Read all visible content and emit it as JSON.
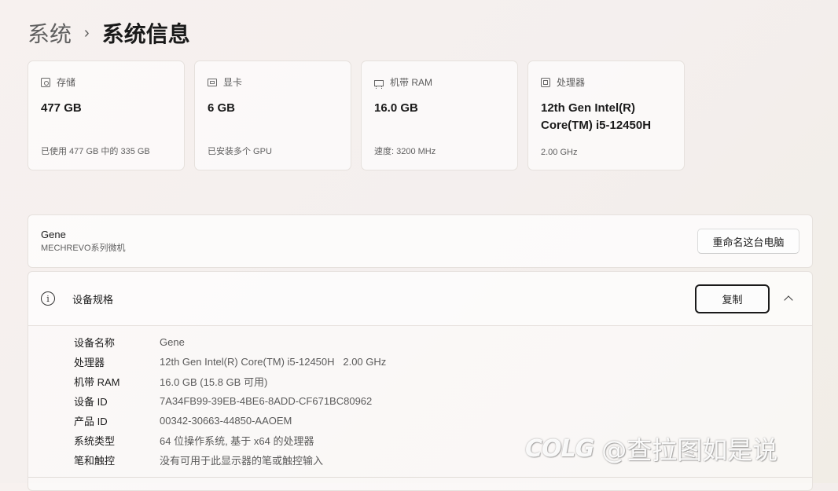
{
  "breadcrumb": {
    "parent": "系统",
    "separator": "›",
    "current": "系统信息"
  },
  "cards": [
    {
      "icon": "storage-icon",
      "title": "存储",
      "value": "477 GB",
      "sub": "已使用 477 GB 中的 335 GB"
    },
    {
      "icon": "gpu-icon",
      "title": "显卡",
      "value": "6 GB",
      "sub": "已安装多个 GPU"
    },
    {
      "icon": "ram-icon",
      "title": "机带 RAM",
      "value": "16.0 GB",
      "sub": "速度: 3200 MHz"
    },
    {
      "icon": "cpu-icon",
      "title": "处理器",
      "value": "12th Gen Intel(R) Core(TM) i5-12450H",
      "sub": "2.00 GHz"
    }
  ],
  "device": {
    "name": "Gene",
    "model": "MECHREVO系列微机",
    "rename_label": "重命名这台电脑"
  },
  "specs": {
    "title": "设备规格",
    "copy_label": "复制",
    "rows": [
      {
        "label": "设备名称",
        "value": "Gene"
      },
      {
        "label": "处理器",
        "value": "12th Gen Intel(R) Core(TM) i5-12450H   2.00 GHz"
      },
      {
        "label": "机带 RAM",
        "value": "16.0 GB (15.8 GB 可用)"
      },
      {
        "label": "设备 ID",
        "value": "7A34FB99-39EB-4BE6-8ADD-CF671BC80962"
      },
      {
        "label": "产品 ID",
        "value": "00342-30663-44850-AAOEM"
      },
      {
        "label": "系统类型",
        "value": "64 位操作系统, 基于 x64 的处理器"
      },
      {
        "label": "笔和触控",
        "value": "没有可用于此显示器的笔或触控输入"
      }
    ]
  },
  "watermark": {
    "logo": "COLG",
    "text": "@查拉图如是说"
  }
}
